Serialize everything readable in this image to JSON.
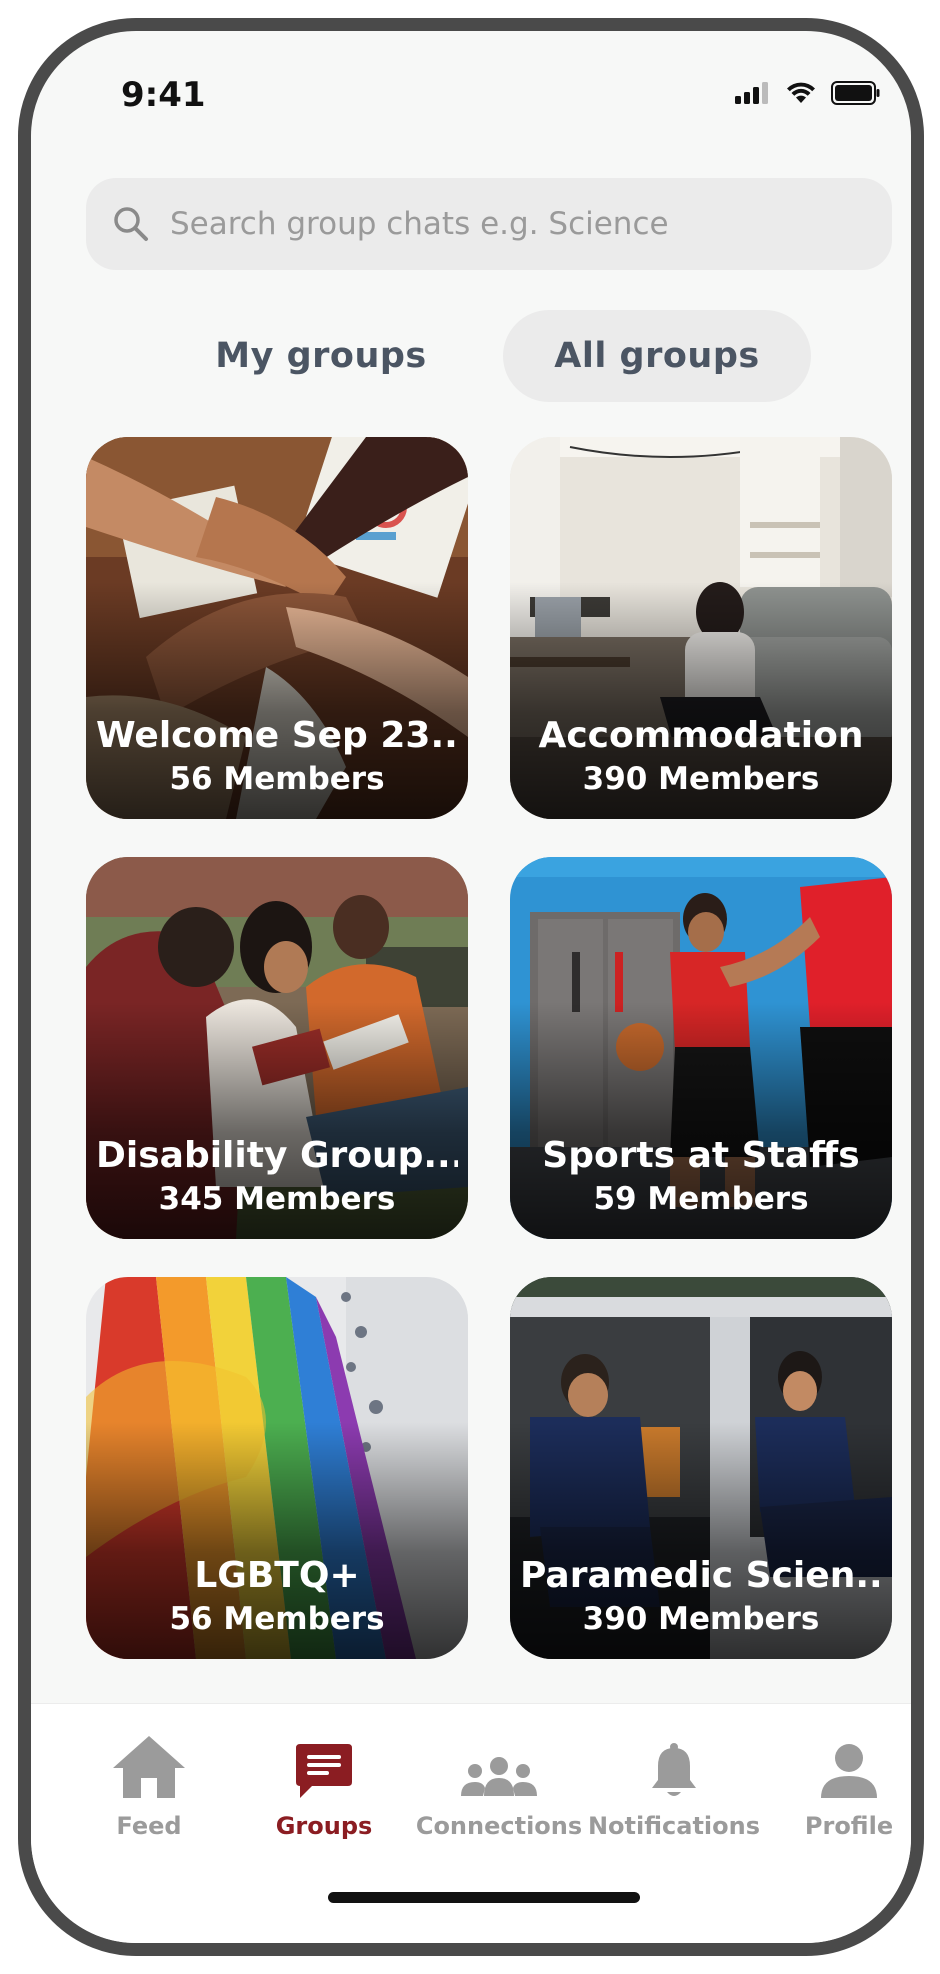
{
  "status_bar": {
    "time": "9:41"
  },
  "search": {
    "placeholder": "Search group chats e.g. Science"
  },
  "tabs": [
    {
      "label": "My groups",
      "selected": false
    },
    {
      "label": "All groups",
      "selected": true
    }
  ],
  "groups": [
    {
      "title": "Welcome Sep 23...",
      "members": "56 Members"
    },
    {
      "title": "Accommodation",
      "members": "390 Members"
    },
    {
      "title": "Disability Group...",
      "members": "345 Members"
    },
    {
      "title": "Sports at Staffs",
      "members": "59 Members"
    },
    {
      "title": "LGBTQ+",
      "members": "56 Members"
    },
    {
      "title": "Paramedic Scien...",
      "members": "390 Members"
    }
  ],
  "nav": [
    {
      "label": "Feed",
      "icon": "home-icon"
    },
    {
      "label": "Groups",
      "icon": "chat-icon",
      "active": true
    },
    {
      "label": "Connections",
      "icon": "people-icon"
    },
    {
      "label": "Notifications",
      "icon": "bell-icon"
    },
    {
      "label": "Profile",
      "icon": "person-icon"
    }
  ],
  "colors": {
    "accent": "#8b1d22",
    "inactive": "#9b9b9b",
    "background": "#f7f8f7"
  }
}
